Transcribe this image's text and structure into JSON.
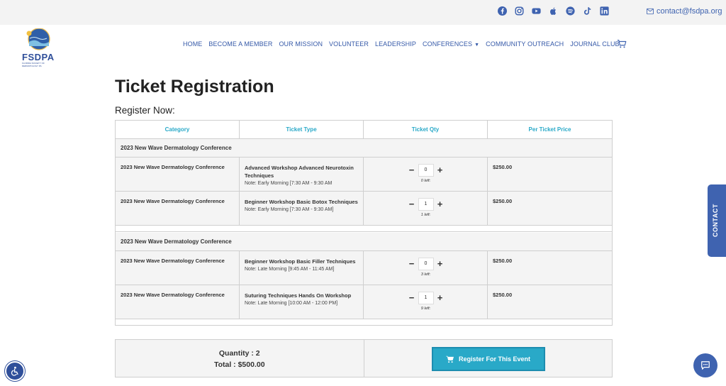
{
  "header": {
    "email": "contact@fsdpa.org",
    "social_icons": [
      "facebook-icon",
      "instagram-icon",
      "youtube-icon",
      "apple-icon",
      "spotify-icon",
      "tiktok-icon",
      "linkedin-icon"
    ],
    "logo_text": "FSDPA",
    "logo_subtext": "FLORIDA SOCIETY OF DERMATOLOGY PA",
    "nav": [
      "HOME",
      "BECOME A MEMBER",
      "OUR MISSION",
      "VOLUNTEER",
      "LEADERSHIP",
      "CONFERENCES",
      "COMMUNITY OUTREACH",
      "JOURNAL CLUB"
    ]
  },
  "page": {
    "title": "Ticket Registration",
    "subtitle": "Register Now:"
  },
  "table": {
    "headers": [
      "Category",
      "Ticket Type",
      "Ticket Qty",
      "Per Ticket Price"
    ],
    "groups": [
      {
        "name": "2023 New Wave Dermatology Conference",
        "rows": [
          {
            "category": "2023 New Wave Dermatology Conference",
            "ticket_type": "Advanced Workshop Advanced Neurotoxin Techniques",
            "note": "Note: Early Morning [7:30 AM - 9:30 AM",
            "qty": "0",
            "left": "0 left:",
            "price": "$250.00"
          },
          {
            "category": "2023 New Wave Dermatology Conference",
            "ticket_type": "Beginner Workshop Basic Botox Techniques",
            "note": "Note: Early Morning [7:30 AM - 9:30 AM]",
            "qty": "1",
            "left": "1 left:",
            "price": "$250.00"
          }
        ]
      },
      {
        "name": "2023 New Wave Dermatology Conference",
        "rows": [
          {
            "category": "2023 New Wave Dermatology Conference",
            "ticket_type": "Beginner Workshop Basic Filler Techniques",
            "note": "Note: Late Morning [9:45 AM - 11:45 AM]",
            "qty": "0",
            "left": "3 left:",
            "price": "$250.00"
          },
          {
            "category": "2023 New Wave Dermatology Conference",
            "ticket_type": "Suturing Techniques Hands On Workshop",
            "note": "Note: Late Morning [10:00 AM - 12:00 PM]",
            "qty": "1",
            "left": "9 left:",
            "price": "$250.00"
          }
        ]
      }
    ]
  },
  "summary": {
    "quantity": "Quantity : 2",
    "total": "Total : $500.00",
    "register_button": "Register For This Event"
  },
  "contact_tab": "CONTACT",
  "colors": {
    "accent": "#29a9c8",
    "brand": "#3f63b0",
    "nav": "#3559a8"
  }
}
